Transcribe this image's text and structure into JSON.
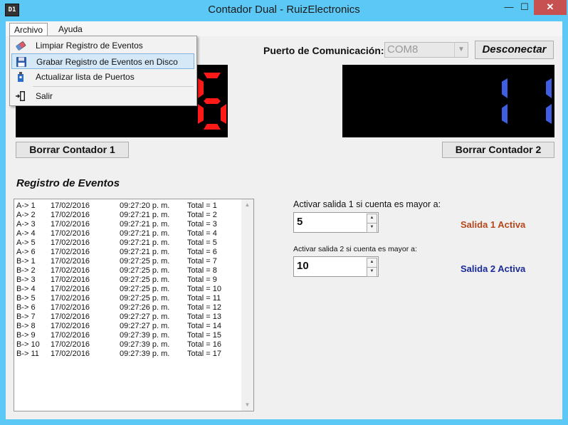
{
  "window": {
    "title": "Contador Dual - RuizElectronics",
    "icon_text": "D1",
    "controls": {
      "minimize": "—",
      "maximize": "☐",
      "close": "✕"
    }
  },
  "menu": {
    "items": [
      "Archivo",
      "Ayuda"
    ],
    "file_menu": [
      {
        "label": "Limpiar Registro de Eventos",
        "icon": "eraser-icon"
      },
      {
        "label": "Grabar Registro de Eventos en Disco",
        "icon": "floppy-disk-icon",
        "highlighted": true
      },
      {
        "label": "Actualizar lista de Puertos",
        "icon": "refresh-ports-icon"
      },
      {
        "label": "Salir",
        "icon": "exit-door-icon"
      }
    ]
  },
  "port": {
    "label": "Puerto de Comunicación:",
    "value": "COM8",
    "disconnect_label": "Desconectar"
  },
  "counters": {
    "counter1": {
      "value": "6",
      "color": "#ff1a1a",
      "clear_label": "Borrar Contador 1"
    },
    "counter2": {
      "value": "11",
      "color": "#3f5fe0",
      "clear_label": "Borrar Contador 2"
    }
  },
  "log": {
    "title": "Registro de Eventos",
    "rows": [
      [
        "A-> 1",
        "17/02/2016",
        "09:27:20 p. m.",
        "Total = 1"
      ],
      [
        "A-> 2",
        "17/02/2016",
        "09:27:21 p. m.",
        "Total = 2"
      ],
      [
        "A-> 3",
        "17/02/2016",
        "09:27:21 p. m.",
        "Total = 3"
      ],
      [
        "A-> 4",
        "17/02/2016",
        "09:27:21 p. m.",
        "Total = 4"
      ],
      [
        "A-> 5",
        "17/02/2016",
        "09:27:21 p. m.",
        "Total = 5"
      ],
      [
        "A-> 6",
        "17/02/2016",
        "09:27:21 p. m.",
        "Total = 6"
      ],
      [
        "B-> 1",
        "17/02/2016",
        "09:27:25 p. m.",
        "Total = 7"
      ],
      [
        "B-> 2",
        "17/02/2016",
        "09:27:25 p. m.",
        "Total = 8"
      ],
      [
        "B-> 3",
        "17/02/2016",
        "09:27:25 p. m.",
        "Total = 9"
      ],
      [
        "B-> 4",
        "17/02/2016",
        "09:27:25 p. m.",
        "Total = 10"
      ],
      [
        "B-> 5",
        "17/02/2016",
        "09:27:25 p. m.",
        "Total = 11"
      ],
      [
        "B-> 6",
        "17/02/2016",
        "09:27:26 p. m.",
        "Total = 12"
      ],
      [
        "B-> 7",
        "17/02/2016",
        "09:27:27 p. m.",
        "Total = 13"
      ],
      [
        "B-> 8",
        "17/02/2016",
        "09:27:27 p. m.",
        "Total = 14"
      ],
      [
        "B-> 9",
        "17/02/2016",
        "09:27:39 p. m.",
        "Total = 15"
      ],
      [
        "B-> 10",
        "17/02/2016",
        "09:27:39 p. m.",
        "Total = 16"
      ],
      [
        "B-> 11",
        "17/02/2016",
        "09:27:39 p. m.",
        "Total = 17"
      ]
    ]
  },
  "outputs": {
    "output1": {
      "label": "Activar salida 1 si cuenta es mayor a:",
      "value": "5",
      "status": "Salida 1 Activa",
      "status_color": "#b5471b"
    },
    "output2": {
      "label": "Activar salida 2 si cuenta es mayor a:",
      "value": "10",
      "status": "Salida 2 Activa",
      "status_color": "#1a2a9a"
    }
  }
}
